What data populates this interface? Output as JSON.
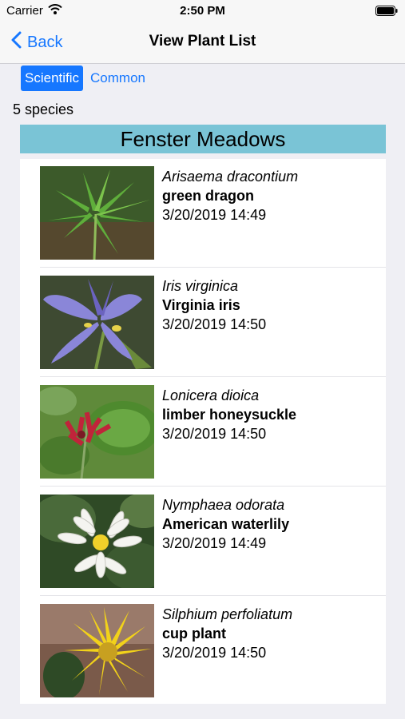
{
  "status_bar": {
    "carrier": "Carrier",
    "time": "2:50 PM"
  },
  "nav": {
    "back_label": "Back",
    "title": "View Plant List"
  },
  "segment": {
    "options": [
      "Scientific",
      "Common"
    ],
    "selected": "Scientific"
  },
  "species_count": "5 species",
  "group": {
    "name": "Fenster Meadows"
  },
  "plants": [
    {
      "scientific": "Arisaema dracontium",
      "common": "green dragon",
      "datetime": "3/20/2019 14:49"
    },
    {
      "scientific": "Iris virginica",
      "common": "Virginia iris",
      "datetime": "3/20/2019 14:50"
    },
    {
      "scientific": "Lonicera dioica",
      "common": "limber honeysuckle",
      "datetime": "3/20/2019 14:50"
    },
    {
      "scientific": "Nymphaea odorata",
      "common": "American waterlily",
      "datetime": "3/20/2019 14:49"
    },
    {
      "scientific": "Silphium perfoliatum",
      "common": "cup plant",
      "datetime": "3/20/2019 14:50"
    }
  ],
  "colors": {
    "accent": "#1677ff",
    "group_header": "#7ac4d6",
    "background": "#efeff4"
  }
}
